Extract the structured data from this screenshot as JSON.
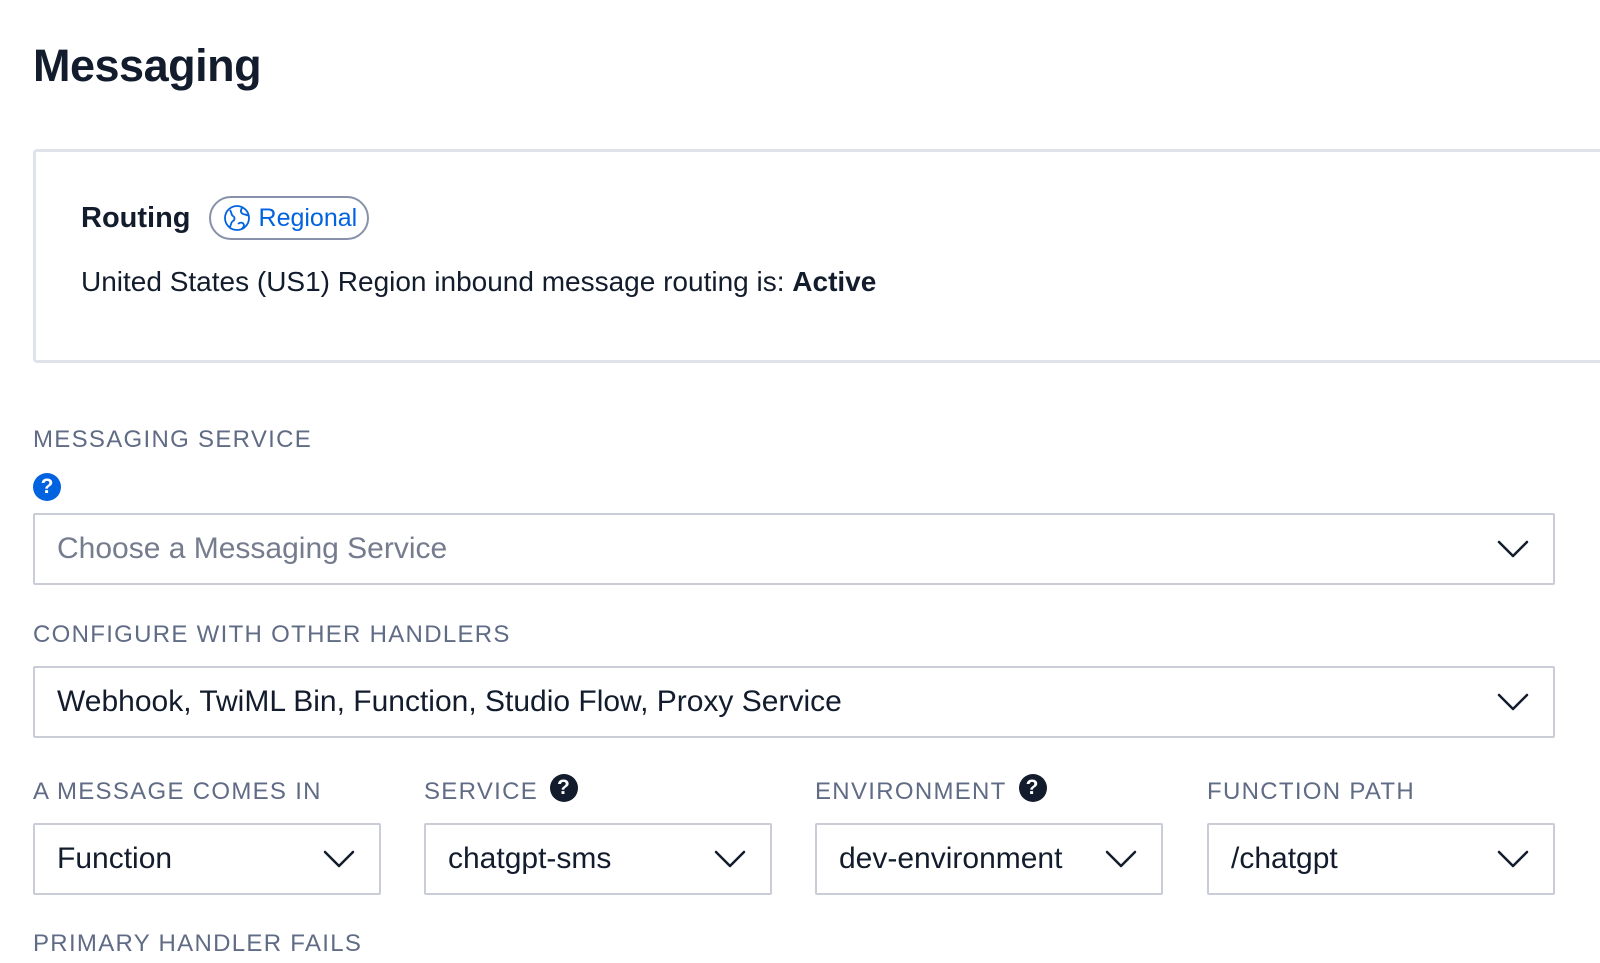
{
  "page": {
    "title": "Messaging"
  },
  "routing": {
    "title": "Routing",
    "badge_label": "Regional",
    "status_prefix": "United States (US1) Region inbound message routing is: ",
    "status_value": "Active"
  },
  "messaging_service": {
    "label": "MESSAGING SERVICE",
    "help_glyph": "?",
    "placeholder": "Choose a Messaging Service"
  },
  "other_handlers": {
    "label": "CONFIGURE WITH OTHER HANDLERS",
    "value": "Webhook, TwiML Bin, Function, Studio Flow, Proxy Service"
  },
  "message_comes_in": {
    "label": "A MESSAGE COMES IN",
    "value": "Function"
  },
  "service": {
    "label": "SERVICE",
    "help_glyph": "?",
    "value": "chatgpt-sms"
  },
  "environment": {
    "label": "ENVIRONMENT",
    "help_glyph": "?",
    "value": "dev-environment"
  },
  "function_path": {
    "label": "FUNCTION PATH",
    "value": "/chatgpt"
  },
  "next_section": {
    "label": "PRIMARY HANDLER FAILS"
  },
  "colors": {
    "link_blue": "#0263e0",
    "text_dark": "#121c2d",
    "label_gray": "#606b85",
    "border_gray": "#cacdd8"
  }
}
